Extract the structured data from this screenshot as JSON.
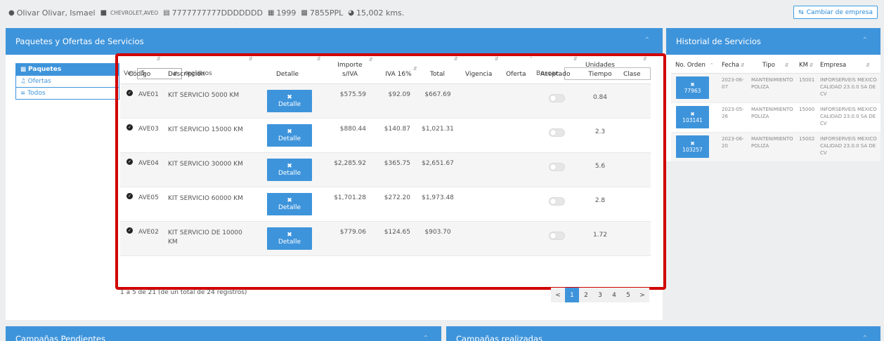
{
  "header": {
    "customer": "Olivar Olivar, Ismael",
    "vehicle": "CHEVROLET,AVEO",
    "vin": "7777777777DDDDDDD",
    "year": "1999",
    "plate": "7855PPL",
    "mileage": "15,002 kms.",
    "change_company_label": "Cambiar de empresa",
    "icons": [
      "user-icon",
      "car-icon",
      "id-card-icon",
      "calendar-icon",
      "plate-icon",
      "dashboard-icon",
      "shuffle-icon"
    ]
  },
  "packages_panel": {
    "title": "Paquetes y Ofertas de Servicios",
    "tabs": [
      {
        "label": "Paquetes",
        "icon": "cubes-icon",
        "active": true
      },
      {
        "label": "Ofertas",
        "icon": "bell-icon",
        "active": false
      },
      {
        "label": "Todos",
        "icon": "list-icon",
        "active": false
      }
    ],
    "show_label": "Ver",
    "page_size": "5",
    "records_label": "registros",
    "search_label": "Buscar:",
    "search_value": "",
    "columns": [
      "Código",
      "Descripción",
      "Detalle",
      "Importe s/IVA",
      "IVA 16%",
      "Total",
      "Vigencia",
      "Oferta",
      "Aceptado",
      "Unidades Tiempo",
      "Clase"
    ],
    "detail_button_label": "Detalle",
    "rows": [
      {
        "code": "AVE01",
        "description": "KIT SERVICIO 5000 KM",
        "importe": "$575.59",
        "iva": "$92.09",
        "total": "$667.69",
        "vigencia": "",
        "oferta": "",
        "aceptado": false,
        "unidades": "0.84",
        "clase": ""
      },
      {
        "code": "AVE03",
        "description": "KIT SERVICIO 15000 KM",
        "importe": "$880.44",
        "iva": "$140.87",
        "total": "$1,021.31",
        "vigencia": "",
        "oferta": "",
        "aceptado": false,
        "unidades": "2.3",
        "clase": ""
      },
      {
        "code": "AVE04",
        "description": "KIT SERVICIO 30000 KM",
        "importe": "$2,285.92",
        "iva": "$365.75",
        "total": "$2,651.67",
        "vigencia": "",
        "oferta": "",
        "aceptado": false,
        "unidades": "5.6",
        "clase": ""
      },
      {
        "code": "AVE05",
        "description": "KIT SERVICIO 60000 KM",
        "importe": "$1,701.28",
        "iva": "$272.20",
        "total": "$1,973.48",
        "vigencia": "",
        "oferta": "",
        "aceptado": false,
        "unidades": "2.8",
        "clase": ""
      },
      {
        "code": "AVE02",
        "description": "KIT SERVICIO DE 10000 KM",
        "importe": "$779.06",
        "iva": "$124.65",
        "total": "$903.70",
        "vigencia": "",
        "oferta": "",
        "aceptado": false,
        "unidades": "1.72",
        "clase": ""
      }
    ],
    "footer_info": "1 a 5 de 21 (de un total de 24 registros)",
    "pagination": [
      "<",
      "1",
      "2",
      "3",
      "4",
      "5",
      ">"
    ],
    "current_page": "1"
  },
  "history_panel": {
    "title": "Historial de Servicios",
    "columns": [
      "No. Orden",
      "Fecha",
      "Tipo",
      "KM",
      "Empresa"
    ],
    "rows": [
      {
        "order": "77963",
        "fecha": "2023-06-07",
        "tipo": "MANTENIMIENTO POLIZA",
        "km": "15001",
        "empresa": "INFORSERVEIS MEXICO CALIDAD 23.0.0 SA DE CV"
      },
      {
        "order": "103141",
        "fecha": "2023-05-26",
        "tipo": "MANTENIMIENTO POLIZA",
        "km": "15000",
        "empresa": "INFORSERVEIS MEXICO CALIDAD 23.0.0 SA DE CV"
      },
      {
        "order": "103257",
        "fecha": "2023-06-20",
        "tipo": "MANTENIMIENTO POLIZA",
        "km": "15002",
        "empresa": "INFORSERVEIS MEXICO CALIDAD 23.0.0 SA DE CV"
      }
    ]
  },
  "pending_panel": {
    "title": "Campañas Pendientes"
  },
  "done_panel": {
    "title": "Campañas realizadas"
  }
}
